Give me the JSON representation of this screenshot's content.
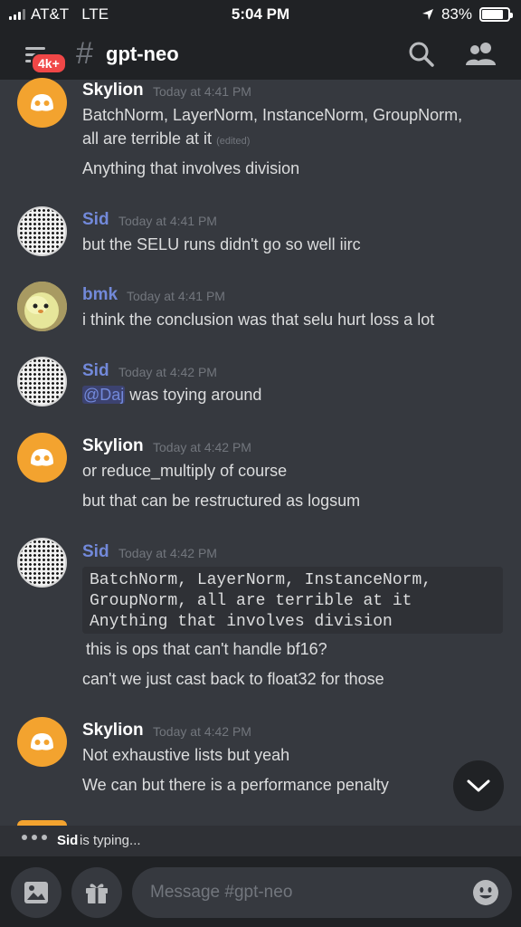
{
  "status_bar": {
    "carrier": "AT&T",
    "network": "LTE",
    "time": "5:04 PM",
    "battery": "83%",
    "battery_level": 0.83,
    "icons": [
      "signal-icon",
      "location-arrow-icon",
      "battery-icon"
    ]
  },
  "header": {
    "badge": "4k+",
    "channel_hash": "#",
    "channel_name": "gpt-neo",
    "icons": [
      "menu-icon",
      "search-icon",
      "members-icon"
    ]
  },
  "messages": [
    {
      "author": "Skylion",
      "author_color": "#ffffff",
      "timestamp": "Today at 4:41 PM",
      "avatar": "discord-logo-icon",
      "lines": [
        "BatchNorm, LayerNorm, InstanceNorm, GroupNorm,",
        "all are terrible at it",
        "Anything that involves division"
      ],
      "edited_label": "(edited)"
    },
    {
      "author": "Sid",
      "author_color": "#7289da",
      "timestamp": "Today at 4:41 PM",
      "avatar": "halftone-avatar",
      "lines": [
        "but the SELU runs didn't go so well iirc"
      ]
    },
    {
      "author": "bmk",
      "author_color": "#7289da",
      "timestamp": "Today at 4:41 PM",
      "avatar": "chick-avatar",
      "lines": [
        "i think the conclusion was that selu hurt loss a lot"
      ]
    },
    {
      "author": "Sid",
      "author_color": "#7289da",
      "timestamp": "Today at 4:42 PM",
      "avatar": "halftone-avatar",
      "mention": "@Daj",
      "lines": [
        " was toying around"
      ]
    },
    {
      "author": "Skylion",
      "author_color": "#ffffff",
      "timestamp": "Today at 4:42 PM",
      "avatar": "discord-logo-icon",
      "lines": [
        "or reduce_multiply of course",
        "but that can be restructured as logsum"
      ]
    },
    {
      "author": "Sid",
      "author_color": "#7289da",
      "timestamp": "Today at 4:42 PM",
      "avatar": "halftone-avatar",
      "code_lines": [
        "BatchNorm, LayerNorm, InstanceNorm,",
        "GroupNorm, all are terrible at it",
        "Anything that involves division"
      ],
      "lines": [
        "this is ops that can't handle bf16?",
        "can't we just cast back to float32 for those"
      ]
    },
    {
      "author": "Skylion",
      "author_color": "#ffffff",
      "timestamp": "Today at 4:42 PM",
      "avatar": "discord-logo-icon",
      "lines": [
        "Not exhaustive lists but yeah",
        "We can but there is a performance penalty"
      ]
    }
  ],
  "typing": {
    "user": "Sid",
    "text": "is typing..."
  },
  "composer": {
    "placeholder": "Message #gpt-neo",
    "icons": [
      "image-icon",
      "gift-icon",
      "emoji-icon"
    ]
  },
  "scroll_button": {
    "icon": "chevron-down-icon"
  }
}
